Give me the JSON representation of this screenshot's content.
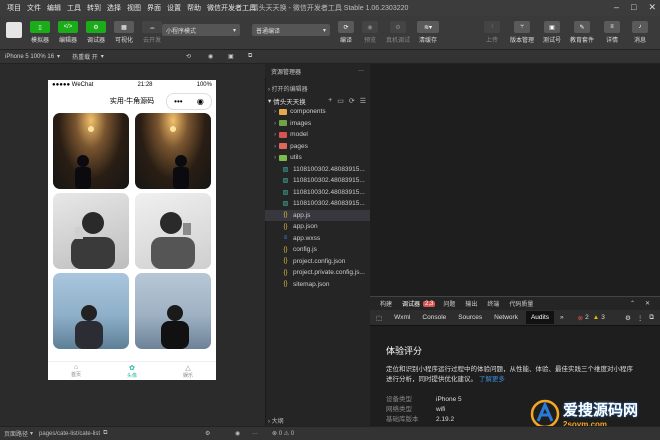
{
  "menubar": {
    "items": [
      "项目",
      "文件",
      "编辑",
      "工具",
      "转到",
      "选择",
      "视图",
      "界面",
      "设置",
      "帮助",
      "微信开发者工具"
    ],
    "title": "情头天天换 - 微信开发者工具 Stable 1.06.2303220"
  },
  "toolbar": {
    "left_buttons": [
      {
        "label": "模拟器",
        "icon": "phone-icon"
      },
      {
        "label": "编辑器",
        "icon": "code-icon"
      },
      {
        "label": "调试器",
        "icon": "debug-icon"
      },
      {
        "label": "可视化",
        "icon": "grid-icon"
      },
      {
        "label": "云开发",
        "icon": "cloud-icon"
      }
    ],
    "mode_select": "小程序模式",
    "compile_select": "普通编译",
    "mid_buttons": [
      "编译",
      "预览",
      "真机调试",
      "清缓存"
    ],
    "right_buttons": [
      "上传",
      "版本管理",
      "测试号",
      "教育套件",
      "详情",
      "消息"
    ]
  },
  "simbar": {
    "device": "iPhone 5 100% 16",
    "hot_reload": "热重载 开"
  },
  "phone": {
    "carrier": "●●●●● WeChat",
    "time": "21:28",
    "battery": "100%",
    "nav_title": "实用-牛角源码",
    "tabs": [
      {
        "label": "首页",
        "icon": "home-icon",
        "active": false
      },
      {
        "label": "头像",
        "icon": "avatar-tab-icon",
        "active": true
      },
      {
        "label": "娱乐",
        "icon": "fun-icon",
        "active": false
      }
    ]
  },
  "explorer": {
    "title": "资源管理器",
    "section_open": "打开的编辑器",
    "project": "情头天天换",
    "items": [
      {
        "name": "components",
        "type": "folder",
        "color": "#e4a94a"
      },
      {
        "name": "images",
        "type": "folder",
        "color": "#6fa34a"
      },
      {
        "name": "model",
        "type": "folder",
        "color": "#d9534f"
      },
      {
        "name": "pages",
        "type": "folder",
        "color": "#e0685a"
      },
      {
        "name": "utils",
        "type": "folder",
        "color": "#7dbb4a"
      },
      {
        "name": "1108100302.48083915...",
        "type": "img",
        "color": "#3fb5a5"
      },
      {
        "name": "1108100302.48083915...",
        "type": "img",
        "color": "#3fb5a5"
      },
      {
        "name": "1108100302.48083915...",
        "type": "img",
        "color": "#3fb5a5"
      },
      {
        "name": "1108100302.48083915...",
        "type": "img",
        "color": "#3fb5a5"
      },
      {
        "name": "app.js",
        "type": "js",
        "color": "#e6c84a",
        "selected": true
      },
      {
        "name": "app.json",
        "type": "json",
        "color": "#e6c84a"
      },
      {
        "name": "app.wxss",
        "type": "css",
        "color": "#3b8edc"
      },
      {
        "name": "config.js",
        "type": "js",
        "color": "#e6c84a"
      },
      {
        "name": "project.config.json",
        "type": "json",
        "color": "#e6c84a"
      },
      {
        "name": "project.private.config.js...",
        "type": "json",
        "color": "#e6c84a"
      },
      {
        "name": "sitemap.json",
        "type": "json",
        "color": "#e6c84a"
      }
    ],
    "outline": "大纲"
  },
  "devtools": {
    "tabs1": [
      "构建",
      "调试器",
      "2,3",
      "问题",
      "输出",
      "终端",
      "代码质量"
    ],
    "tabs2": [
      "Wxml",
      "Console",
      "Sources",
      "Network",
      "Audits"
    ],
    "active_tab": "Audits",
    "errors": "2",
    "warnings": "3",
    "heading": "体验评分",
    "desc": "定位和识别小程序运行过程中的体验问题，从性能、体验、最佳实践三个维度对小程序进行分析，同时提供优化建议。",
    "learn_more": "了解更多",
    "rows": [
      {
        "k": "设备类型",
        "v": "iPhone 5"
      },
      {
        "k": "网络类型",
        "v": "wifi"
      },
      {
        "k": "基础库版本",
        "v": "2.19.2"
      }
    ]
  },
  "bottombar": {
    "path_label": "页面路径",
    "path": "pages/cate-list/cate-list"
  },
  "watermark": {
    "text": "爱搜源码网",
    "sub": "2soym.com"
  }
}
